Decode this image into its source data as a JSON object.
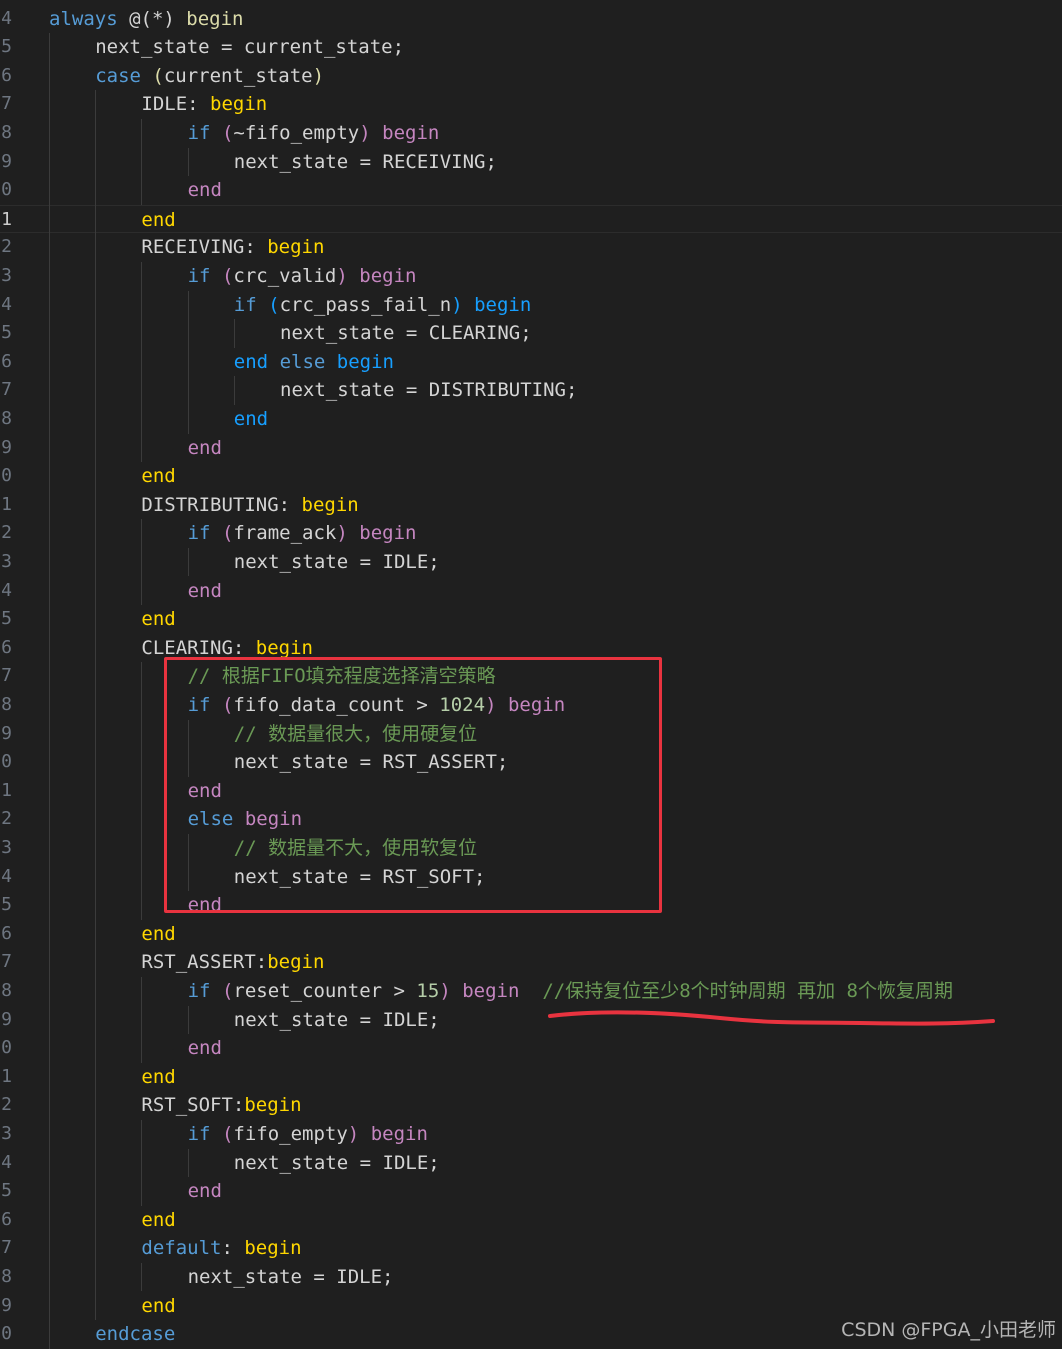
{
  "editor": {
    "language": "verilog",
    "theme": "dark",
    "current_line_index": 7,
    "lines": [
      {
        "ln": "4",
        "indent": 0,
        "tokens": [
          [
            "kw",
            "always"
          ],
          [
            "p",
            " @(*) "
          ],
          [
            "y",
            "begin"
          ]
        ]
      },
      {
        "ln": "5",
        "indent": 1,
        "tokens": [
          [
            "p",
            "next_state = current_state;"
          ]
        ]
      },
      {
        "ln": "6",
        "indent": 1,
        "tokens": [
          [
            "kw",
            "case"
          ],
          [
            "p",
            " "
          ],
          [
            "y",
            "("
          ],
          [
            "p",
            "current_state"
          ],
          [
            "y",
            ")"
          ]
        ]
      },
      {
        "ln": "7",
        "indent": 2,
        "tokens": [
          [
            "p",
            "IDLE: "
          ],
          [
            "gold",
            "begin"
          ]
        ]
      },
      {
        "ln": "8",
        "indent": 3,
        "tokens": [
          [
            "kw",
            "if"
          ],
          [
            "p",
            " "
          ],
          [
            "ctl",
            "("
          ],
          [
            "p",
            "~fifo_empty"
          ],
          [
            "ctl",
            ")"
          ],
          [
            "p",
            " "
          ],
          [
            "beg",
            "begin"
          ]
        ]
      },
      {
        "ln": "9",
        "indent": 4,
        "tokens": [
          [
            "p",
            "next_state = RECEIVING;"
          ]
        ]
      },
      {
        "ln": "0",
        "indent": 3,
        "tokens": [
          [
            "beg",
            "end"
          ]
        ]
      },
      {
        "ln": "1",
        "indent": 2,
        "tokens": [
          [
            "gold",
            "end"
          ]
        ]
      },
      {
        "ln": "2",
        "indent": 2,
        "tokens": [
          [
            "p",
            "RECEIVING: "
          ],
          [
            "gold",
            "begin"
          ]
        ]
      },
      {
        "ln": "3",
        "indent": 3,
        "tokens": [
          [
            "kw",
            "if"
          ],
          [
            "p",
            " "
          ],
          [
            "ctl",
            "("
          ],
          [
            "p",
            "crc_valid"
          ],
          [
            "ctl",
            ")"
          ],
          [
            "p",
            " "
          ],
          [
            "beg",
            "begin"
          ]
        ]
      },
      {
        "ln": "4",
        "indent": 4,
        "tokens": [
          [
            "kw",
            "if"
          ],
          [
            "p",
            " "
          ],
          [
            "bl",
            "("
          ],
          [
            "p",
            "crc_pass_fail_n"
          ],
          [
            "bl",
            ")"
          ],
          [
            "p",
            " "
          ],
          [
            "bl",
            "begin"
          ]
        ]
      },
      {
        "ln": "5",
        "indent": 5,
        "tokens": [
          [
            "p",
            "next_state = CLEARING;"
          ]
        ]
      },
      {
        "ln": "6",
        "indent": 4,
        "tokens": [
          [
            "bl",
            "end"
          ],
          [
            "p",
            " "
          ],
          [
            "kw",
            "else"
          ],
          [
            "p",
            " "
          ],
          [
            "bl",
            "begin"
          ]
        ]
      },
      {
        "ln": "7",
        "indent": 5,
        "tokens": [
          [
            "p",
            "next_state = DISTRIBUTING;"
          ]
        ]
      },
      {
        "ln": "8",
        "indent": 4,
        "tokens": [
          [
            "bl",
            "end"
          ]
        ]
      },
      {
        "ln": "9",
        "indent": 3,
        "tokens": [
          [
            "beg",
            "end"
          ]
        ]
      },
      {
        "ln": "0",
        "indent": 2,
        "tokens": [
          [
            "gold",
            "end"
          ]
        ]
      },
      {
        "ln": "1",
        "indent": 2,
        "tokens": [
          [
            "p",
            "DISTRIBUTING: "
          ],
          [
            "gold",
            "begin"
          ]
        ]
      },
      {
        "ln": "2",
        "indent": 3,
        "tokens": [
          [
            "kw",
            "if"
          ],
          [
            "p",
            " "
          ],
          [
            "ctl",
            "("
          ],
          [
            "p",
            "frame_ack"
          ],
          [
            "ctl",
            ")"
          ],
          [
            "p",
            " "
          ],
          [
            "beg",
            "begin"
          ]
        ]
      },
      {
        "ln": "3",
        "indent": 4,
        "tokens": [
          [
            "p",
            "next_state = IDLE;"
          ]
        ]
      },
      {
        "ln": "4",
        "indent": 3,
        "tokens": [
          [
            "beg",
            "end"
          ]
        ]
      },
      {
        "ln": "5",
        "indent": 2,
        "tokens": [
          [
            "gold",
            "end"
          ]
        ]
      },
      {
        "ln": "6",
        "indent": 2,
        "tokens": [
          [
            "p",
            "CLEARING: "
          ],
          [
            "gold",
            "begin"
          ]
        ]
      },
      {
        "ln": "7",
        "indent": 3,
        "tokens": [
          [
            "cmt",
            "// 根据FIFO填充程度选择清空策略"
          ]
        ]
      },
      {
        "ln": "8",
        "indent": 3,
        "tokens": [
          [
            "kw",
            "if"
          ],
          [
            "p",
            " "
          ],
          [
            "ctl",
            "("
          ],
          [
            "p",
            "fifo_data_count > "
          ],
          [
            "num",
            "1024"
          ],
          [
            "ctl",
            ")"
          ],
          [
            "p",
            " "
          ],
          [
            "beg",
            "begin"
          ]
        ]
      },
      {
        "ln": "9",
        "indent": 4,
        "tokens": [
          [
            "cmt",
            "// 数据量很大，使用硬复位"
          ]
        ]
      },
      {
        "ln": "0",
        "indent": 4,
        "tokens": [
          [
            "p",
            "next_state = RST_ASSERT;"
          ]
        ]
      },
      {
        "ln": "1",
        "indent": 3,
        "tokens": [
          [
            "beg",
            "end"
          ]
        ]
      },
      {
        "ln": "2",
        "indent": 3,
        "tokens": [
          [
            "kw",
            "else"
          ],
          [
            "p",
            " "
          ],
          [
            "beg",
            "begin"
          ]
        ]
      },
      {
        "ln": "3",
        "indent": 4,
        "tokens": [
          [
            "cmt",
            "// 数据量不大，使用软复位"
          ]
        ]
      },
      {
        "ln": "4",
        "indent": 4,
        "tokens": [
          [
            "p",
            "next_state = RST_SOFT;"
          ]
        ]
      },
      {
        "ln": "5",
        "indent": 3,
        "tokens": [
          [
            "beg",
            "end"
          ]
        ]
      },
      {
        "ln": "6",
        "indent": 2,
        "tokens": [
          [
            "gold",
            "end"
          ]
        ]
      },
      {
        "ln": "7",
        "indent": 2,
        "tokens": [
          [
            "p",
            "RST_ASSERT:"
          ],
          [
            "gold",
            "begin"
          ]
        ]
      },
      {
        "ln": "8",
        "indent": 3,
        "tokens": [
          [
            "kw",
            "if"
          ],
          [
            "p",
            " "
          ],
          [
            "ctl",
            "("
          ],
          [
            "p",
            "reset_counter > "
          ],
          [
            "num",
            "15"
          ],
          [
            "ctl",
            ")"
          ],
          [
            "p",
            " "
          ],
          [
            "beg",
            "begin"
          ],
          [
            "p",
            "  "
          ],
          [
            "cmt",
            "//保持复位至少8个时钟周期 再加 8个恢复周期"
          ]
        ]
      },
      {
        "ln": "9",
        "indent": 4,
        "tokens": [
          [
            "p",
            "next_state = IDLE;"
          ]
        ]
      },
      {
        "ln": "0",
        "indent": 3,
        "tokens": [
          [
            "beg",
            "end"
          ]
        ]
      },
      {
        "ln": "1",
        "indent": 2,
        "tokens": [
          [
            "gold",
            "end"
          ]
        ]
      },
      {
        "ln": "2",
        "indent": 2,
        "tokens": [
          [
            "p",
            "RST_SOFT:"
          ],
          [
            "gold",
            "begin"
          ]
        ]
      },
      {
        "ln": "3",
        "indent": 3,
        "tokens": [
          [
            "kw",
            "if"
          ],
          [
            "p",
            " "
          ],
          [
            "ctl",
            "("
          ],
          [
            "p",
            "fifo_empty"
          ],
          [
            "ctl",
            ")"
          ],
          [
            "p",
            " "
          ],
          [
            "beg",
            "begin"
          ]
        ]
      },
      {
        "ln": "4",
        "indent": 4,
        "tokens": [
          [
            "p",
            "next_state = IDLE;"
          ]
        ]
      },
      {
        "ln": "5",
        "indent": 3,
        "tokens": [
          [
            "beg",
            "end"
          ]
        ]
      },
      {
        "ln": "6",
        "indent": 2,
        "tokens": [
          [
            "gold",
            "end"
          ]
        ]
      },
      {
        "ln": "7",
        "indent": 2,
        "tokens": [
          [
            "kw",
            "default"
          ],
          [
            "p",
            ": "
          ],
          [
            "gold",
            "begin"
          ]
        ]
      },
      {
        "ln": "8",
        "indent": 3,
        "tokens": [
          [
            "p",
            "next_state = IDLE;"
          ]
        ]
      },
      {
        "ln": "9",
        "indent": 2,
        "tokens": [
          [
            "gold",
            "end"
          ]
        ]
      },
      {
        "ln": "0",
        "indent": 1,
        "tokens": [
          [
            "kw",
            "endcase"
          ]
        ]
      }
    ]
  },
  "annotations": {
    "box_color": "#e8333f",
    "underline_color": "#e8333f"
  },
  "watermark": "CSDN @FPGA_小田老师"
}
